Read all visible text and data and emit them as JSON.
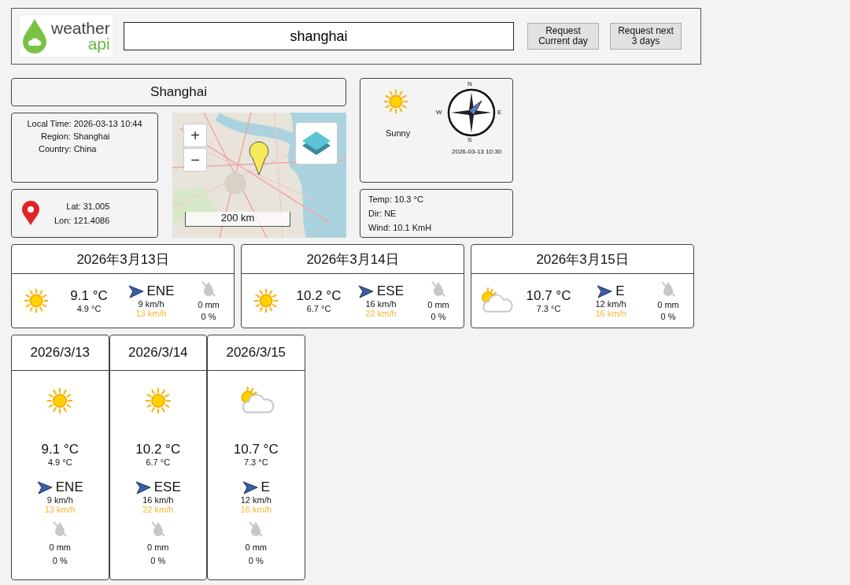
{
  "header": {
    "logo": {
      "line1": "weather",
      "line2": "api"
    },
    "search": {
      "value": "shanghai"
    },
    "buttons": [
      {
        "line1": "Request",
        "line2": "Current day"
      },
      {
        "line1": "Request next",
        "line2": "3 days"
      }
    ]
  },
  "location": {
    "city": "Shanghai",
    "local_time": "Local Time: 2026-03-13 10:44",
    "region": "Region: Shanghai",
    "country": "Country: China",
    "lat": "Lat: 31.005",
    "lon": "Lon: 121.4086"
  },
  "map": {
    "zoom_in": "+",
    "zoom_out": "−",
    "scale": "200 km"
  },
  "current": {
    "kind": "sunny",
    "label": "Sunny",
    "updated": "2026-03-13 10:30",
    "compass": {
      "n": "N",
      "e": "E",
      "s": "S",
      "w": "W"
    },
    "temp": "Temp: 10.3 °C",
    "dir": "Dir: NE",
    "wind": "Wind: 10.1 KmH"
  },
  "forecast_wide": [
    {
      "date": "2026年3月13日",
      "kind": "sunny",
      "max": "9.1 °C",
      "min": "4.9 °C",
      "dir": "ENE",
      "wind": "9 km/h",
      "gust": "13 km/h",
      "rain": "0 mm",
      "chance": "0 %"
    },
    {
      "date": "2026年3月14日",
      "kind": "sunny",
      "max": "10.2 °C",
      "min": "6.7 °C",
      "dir": "ESE",
      "wind": "16 km/h",
      "gust": "22 km/h",
      "rain": "0 mm",
      "chance": "0 %"
    },
    {
      "date": "2026年3月15日",
      "kind": "cloudy",
      "max": "10.7 °C",
      "min": "7.3 °C",
      "dir": "E",
      "wind": "12 km/h",
      "gust": "16 km/h",
      "rain": "0 mm",
      "chance": "0 %"
    }
  ],
  "forecast_tall": [
    {
      "date": "2026/3/13",
      "kind": "sunny",
      "max": "9.1 °C",
      "min": "4.9 °C",
      "dir": "ENE",
      "wind": "9 km/h",
      "gust": "13 km/h",
      "rain": "0 mm",
      "chance": "0 %"
    },
    {
      "date": "2026/3/14",
      "kind": "sunny",
      "max": "10.2 °C",
      "min": "6.7 °C",
      "dir": "ESE",
      "wind": "16 km/h",
      "gust": "22 km/h",
      "rain": "0 mm",
      "chance": "0 %"
    },
    {
      "date": "2026/3/15",
      "kind": "cloudy",
      "max": "10.7 °C",
      "min": "7.3 °C",
      "dir": "E",
      "wind": "12 km/h",
      "gust": "16 km/h",
      "rain": "0 mm",
      "chance": "0 %"
    }
  ]
}
